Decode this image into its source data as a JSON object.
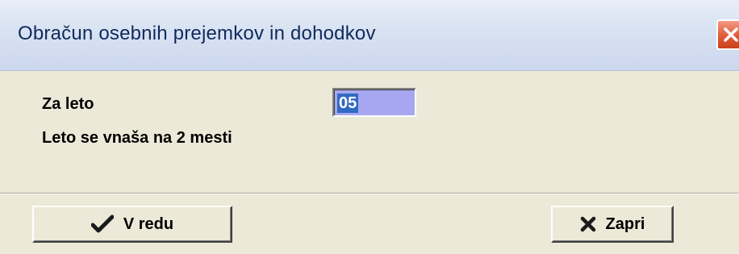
{
  "window": {
    "title": "Obračun osebnih prejemkov in dohodkov"
  },
  "form": {
    "year_label": "Za leto",
    "year_value": "05",
    "hint": "Leto se vnaša na 2 mesti"
  },
  "buttons": {
    "ok_label": "V redu",
    "close_label": "Zapri"
  },
  "icons": {
    "ok": "checkmark-icon",
    "close": "x-icon",
    "titlebar_close": "close-icon"
  },
  "colors": {
    "window_bg": "#ece9d8",
    "input_bg": "#a7a7f1",
    "selection": "#316ac5",
    "close_button": "#e05a35"
  }
}
